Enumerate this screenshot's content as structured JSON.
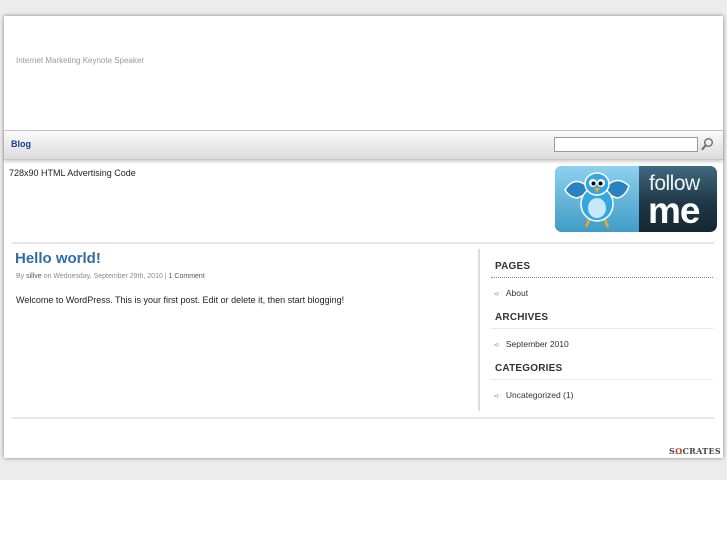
{
  "header": {
    "tagline": "Internet Marketing Keynote Speaker"
  },
  "nav": {
    "items": [
      {
        "label": "Blog"
      }
    ],
    "search": {
      "placeholder": "",
      "value": ""
    }
  },
  "ad": {
    "text": "728x90 HTML Advertising Code"
  },
  "banner": {
    "line1": "follow",
    "line2": "me"
  },
  "post": {
    "title": "Hello world!",
    "meta": {
      "by": "By",
      "author": "sillve",
      "on": "on Wednesday, September 29th, 2010 |",
      "comments": "1 Comment"
    },
    "body": "Welcome to WordPress. This is your first post. Edit or delete it, then start blogging!"
  },
  "sidebar": {
    "pages": {
      "title": "PAGES",
      "items": [
        "About"
      ]
    },
    "archives": {
      "title": "ARCHIVES",
      "items": [
        "September 2010"
      ]
    },
    "categories": {
      "title": "CATEGORIES",
      "items": [
        "Uncategorized (1)"
      ]
    }
  },
  "footer": {
    "logo_pre": "S",
    "logo_omega": "Ω",
    "logo_post": "CRATES"
  },
  "colors": {
    "title_link": "#2f6da3",
    "nav_link": "#1a3a9a",
    "banner_dark": "#203847",
    "banner_light": "#8fd0ee"
  },
  "icons": {
    "search": "magnifier-icon",
    "bullet": "arrow-bullet-icon",
    "bird": "twitter-bird-icon"
  }
}
